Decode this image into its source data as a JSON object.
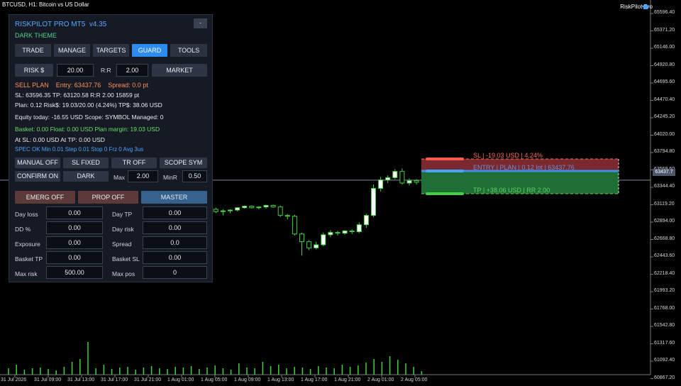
{
  "header": {
    "symbol": "BTCUSD, H1:  Bitcoin vs US Dollar",
    "brand": "RiskPilot Pro",
    "brand_icon": "graduation-cap-icon"
  },
  "price_axis": {
    "labels": [
      "65596.40",
      "65371.20",
      "65146.00",
      "64920.80",
      "64695.60",
      "64470.40",
      "64245.20",
      "64020.00",
      "63794.80",
      "63569.60",
      "63344.40",
      "63119.20",
      "62894.00",
      "62668.80",
      "62443.60",
      "62218.40",
      "61993.20",
      "61768.00",
      "61542.80",
      "61317.60",
      "61092.40",
      "60867.20"
    ],
    "current": "63437.7"
  },
  "time_axis": {
    "labels": [
      "31 Jul 2026",
      "31 Jul 09:00",
      "31 Jul 13:00",
      "31 Jul 17:00",
      "31 Jul 21:00",
      "1 Aug 01:00",
      "1 Aug 05:00",
      "1 Aug 09:00",
      "1 Aug 13:00",
      "1 Aug 17:00",
      "1 Aug 21:00",
      "2 Aug 01:00",
      "2 Aug 05:00"
    ]
  },
  "overlay": {
    "sl": "SL  |  -19.03 USD  |  4.24%",
    "entry": "ENTRY  |  PLAN  |  0.12 lot  |  63437.76",
    "tp": "TP  |  +38.06 USD  |  RR 2.00"
  },
  "chart_data": {
    "type": "candlestick",
    "candles": [
      {
        "o": 63080,
        "h": 63130,
        "l": 63040,
        "c": 63110
      },
      {
        "o": 63110,
        "h": 63140,
        "l": 63070,
        "c": 63090
      },
      {
        "o": 63090,
        "h": 63120,
        "l": 63060,
        "c": 63080
      },
      {
        "o": 63080,
        "h": 63110,
        "l": 63040,
        "c": 63070
      },
      {
        "o": 63070,
        "h": 63100,
        "l": 63040,
        "c": 63060
      },
      {
        "o": 63060,
        "h": 63090,
        "l": 63030,
        "c": 63080
      },
      {
        "o": 63080,
        "h": 63100,
        "l": 63050,
        "c": 63070
      },
      {
        "o": 63070,
        "h": 63090,
        "l": 62990,
        "c": 63080
      },
      {
        "o": 63080,
        "h": 63100,
        "l": 63050,
        "c": 63090
      },
      {
        "o": 63090,
        "h": 63110,
        "l": 63060,
        "c": 63100
      },
      {
        "o": 63100,
        "h": 63120,
        "l": 63060,
        "c": 63070
      },
      {
        "o": 63070,
        "h": 63090,
        "l": 63050,
        "c": 63080
      },
      {
        "o": 63080,
        "h": 63110,
        "l": 63060,
        "c": 63090
      },
      {
        "o": 63090,
        "h": 63120,
        "l": 63040,
        "c": 63100
      },
      {
        "o": 63100,
        "h": 63110,
        "l": 63060,
        "c": 63080
      },
      {
        "o": 63080,
        "h": 63100,
        "l": 63060,
        "c": 63070
      },
      {
        "o": 63070,
        "h": 63090,
        "l": 63030,
        "c": 63050
      },
      {
        "o": 63050,
        "h": 63080,
        "l": 63030,
        "c": 63060
      },
      {
        "o": 63060,
        "h": 63090,
        "l": 63040,
        "c": 63070
      },
      {
        "o": 63070,
        "h": 63100,
        "l": 63050,
        "c": 63090
      },
      {
        "o": 63090,
        "h": 63110,
        "l": 63060,
        "c": 63100
      },
      {
        "o": 63100,
        "h": 63120,
        "l": 63070,
        "c": 63090
      },
      {
        "o": 63090,
        "h": 63100,
        "l": 63040,
        "c": 63060
      },
      {
        "o": 63060,
        "h": 63080,
        "l": 63010,
        "c": 63030
      },
      {
        "o": 63030,
        "h": 63060,
        "l": 62980,
        "c": 63040
      },
      {
        "o": 63040,
        "h": 63060,
        "l": 63010,
        "c": 63050
      },
      {
        "o": 63050,
        "h": 63090,
        "l": 63030,
        "c": 63080
      },
      {
        "o": 63080,
        "h": 63110,
        "l": 63070,
        "c": 63100
      },
      {
        "o": 63100,
        "h": 63110,
        "l": 63070,
        "c": 63080
      },
      {
        "o": 63080,
        "h": 63100,
        "l": 63060,
        "c": 63090
      },
      {
        "o": 63090,
        "h": 63120,
        "l": 63070,
        "c": 63110
      },
      {
        "o": 63110,
        "h": 63120,
        "l": 63080,
        "c": 63090
      },
      {
        "o": 63090,
        "h": 63110,
        "l": 62960,
        "c": 62980
      },
      {
        "o": 62980,
        "h": 63000,
        "l": 62930,
        "c": 62970
      },
      {
        "o": 62970,
        "h": 62990,
        "l": 62720,
        "c": 62740
      },
      {
        "o": 62740,
        "h": 62760,
        "l": 62460,
        "c": 62640
      },
      {
        "o": 62640,
        "h": 62660,
        "l": 62530,
        "c": 62560
      },
      {
        "o": 62560,
        "h": 62640,
        "l": 62540,
        "c": 62600
      },
      {
        "o": 62600,
        "h": 62760,
        "l": 62580,
        "c": 62730
      },
      {
        "o": 62730,
        "h": 62790,
        "l": 62700,
        "c": 62760
      },
      {
        "o": 62760,
        "h": 62780,
        "l": 62720,
        "c": 62750
      },
      {
        "o": 62750,
        "h": 62790,
        "l": 62730,
        "c": 62780
      },
      {
        "o": 62780,
        "h": 62800,
        "l": 62740,
        "c": 62770
      },
      {
        "o": 62770,
        "h": 62890,
        "l": 62750,
        "c": 62860
      },
      {
        "o": 62860,
        "h": 63000,
        "l": 62820,
        "c": 62980
      },
      {
        "o": 62980,
        "h": 63380,
        "l": 62960,
        "c": 63330
      },
      {
        "o": 63330,
        "h": 63480,
        "l": 63290,
        "c": 63440
      },
      {
        "o": 63440,
        "h": 63500,
        "l": 63400,
        "c": 63470
      },
      {
        "o": 63470,
        "h": 63580,
        "l": 63450,
        "c": 63550
      },
      {
        "o": 63550,
        "h": 63590,
        "l": 63380,
        "c": 63400
      },
      {
        "o": 63400,
        "h": 63460,
        "l": 63370,
        "c": 63430
      },
      {
        "o": 63430,
        "h": 63450,
        "l": 63380,
        "c": 63410
      },
      {
        "o": 63410,
        "h": 63460,
        "l": 63390,
        "c": 63438
      }
    ],
    "volumes": [
      9,
      14,
      7,
      9,
      10,
      8,
      6,
      11,
      18,
      22,
      46,
      9,
      14,
      8,
      10,
      11,
      7,
      10,
      12,
      9,
      8,
      11,
      10,
      12,
      8,
      10,
      13,
      9,
      7,
      16,
      10,
      9,
      18,
      12,
      14,
      9,
      11,
      10,
      8,
      12,
      10,
      9,
      14,
      11,
      13,
      17,
      22,
      18,
      26,
      21,
      16,
      11,
      5
    ]
  },
  "panel": {
    "title": "RISKPILOT PRO MT5",
    "version": "v4.35",
    "theme": "DARK THEME",
    "minimize": "-",
    "tabs": [
      "TRADE",
      "MANAGE",
      "TARGETS",
      "GUARD",
      "TOOLS"
    ],
    "risk_btn": "RISK $",
    "risk_val": "20.00",
    "rr_lbl": "R:R",
    "rr_val": "2.00",
    "market_btn": "MARKET",
    "plan_title": "SELL PLAN",
    "plan_entry": "Entry: 63437.76",
    "plan_spread": "Spread: 0.0 pt",
    "line_sl_tp": "SL: 63596.35    TP: 63120.58    R:R 2.00    15859 pt",
    "line_plan": "Plan: 0.12    Risk$: 19.03/20.00 (4.24%)    TP$: 38.06 USD",
    "line_equity": "Equity today: -16.55 USD    Scope: SYMBOL    Managed: 0",
    "line_basket": "Basket: 0.00    Float: 0.00 USD    Plan margin: 19.03 USD",
    "line_at": "At SL: 0.00 USD     At TP: 0.00 USD",
    "line_spec": "SPEC OK Min 0.01 Step 0.01 Stop 0 Frz 0 Avg 3us",
    "row1": [
      "MANUAL OFF",
      "SL FIXED",
      "TR OFF",
      "SCOPE SYM"
    ],
    "confirm": "CONFIRM ON",
    "dark": "DARK",
    "max_lbl": "Max",
    "max_val": "2.00",
    "minr_lbl": "MinR",
    "minr_val": "0.50",
    "emerg": "EMERG OFF",
    "prop": "PROP OFF",
    "master": "MASTER",
    "grid": [
      {
        "l": "Day loss",
        "v": "0.00",
        "l2": "Day TP",
        "v2": "0.00"
      },
      {
        "l": "DD %",
        "v": "0.00",
        "l2": "Day risk",
        "v2": "0.00"
      },
      {
        "l": "Exposure",
        "v": "0.00",
        "l2": "Spread",
        "v2": "0.0"
      },
      {
        "l": "Basket TP",
        "v": "0.00",
        "l2": "Basket SL",
        "v2": "0.00"
      },
      {
        "l": "Max risk",
        "v": "500.00",
        "l2": "Max pos",
        "v2": "0"
      }
    ]
  }
}
